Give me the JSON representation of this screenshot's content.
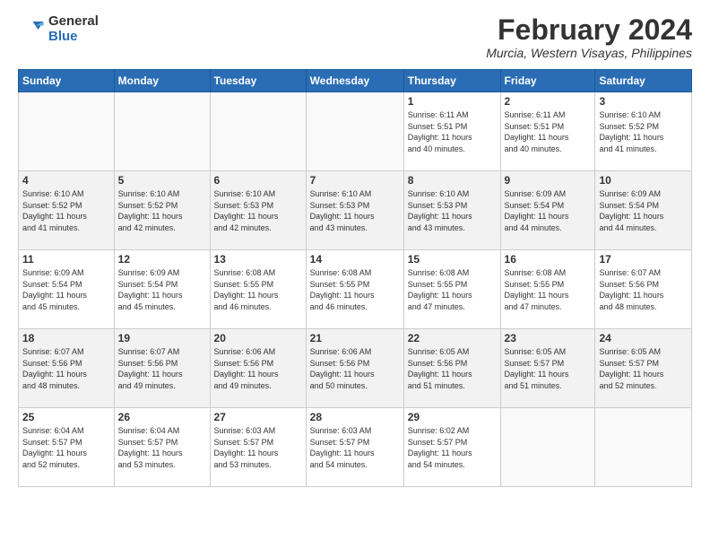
{
  "logo": {
    "general": "General",
    "blue": "Blue"
  },
  "title": "February 2024",
  "location": "Murcia, Western Visayas, Philippines",
  "weekdays": [
    "Sunday",
    "Monday",
    "Tuesday",
    "Wednesday",
    "Thursday",
    "Friday",
    "Saturday"
  ],
  "weeks": [
    [
      {
        "day": "",
        "info": ""
      },
      {
        "day": "",
        "info": ""
      },
      {
        "day": "",
        "info": ""
      },
      {
        "day": "",
        "info": ""
      },
      {
        "day": "1",
        "info": "Sunrise: 6:11 AM\nSunset: 5:51 PM\nDaylight: 11 hours\nand 40 minutes."
      },
      {
        "day": "2",
        "info": "Sunrise: 6:11 AM\nSunset: 5:51 PM\nDaylight: 11 hours\nand 40 minutes."
      },
      {
        "day": "3",
        "info": "Sunrise: 6:10 AM\nSunset: 5:52 PM\nDaylight: 11 hours\nand 41 minutes."
      }
    ],
    [
      {
        "day": "4",
        "info": "Sunrise: 6:10 AM\nSunset: 5:52 PM\nDaylight: 11 hours\nand 41 minutes."
      },
      {
        "day": "5",
        "info": "Sunrise: 6:10 AM\nSunset: 5:52 PM\nDaylight: 11 hours\nand 42 minutes."
      },
      {
        "day": "6",
        "info": "Sunrise: 6:10 AM\nSunset: 5:53 PM\nDaylight: 11 hours\nand 42 minutes."
      },
      {
        "day": "7",
        "info": "Sunrise: 6:10 AM\nSunset: 5:53 PM\nDaylight: 11 hours\nand 43 minutes."
      },
      {
        "day": "8",
        "info": "Sunrise: 6:10 AM\nSunset: 5:53 PM\nDaylight: 11 hours\nand 43 minutes."
      },
      {
        "day": "9",
        "info": "Sunrise: 6:09 AM\nSunset: 5:54 PM\nDaylight: 11 hours\nand 44 minutes."
      },
      {
        "day": "10",
        "info": "Sunrise: 6:09 AM\nSunset: 5:54 PM\nDaylight: 11 hours\nand 44 minutes."
      }
    ],
    [
      {
        "day": "11",
        "info": "Sunrise: 6:09 AM\nSunset: 5:54 PM\nDaylight: 11 hours\nand 45 minutes."
      },
      {
        "day": "12",
        "info": "Sunrise: 6:09 AM\nSunset: 5:54 PM\nDaylight: 11 hours\nand 45 minutes."
      },
      {
        "day": "13",
        "info": "Sunrise: 6:08 AM\nSunset: 5:55 PM\nDaylight: 11 hours\nand 46 minutes."
      },
      {
        "day": "14",
        "info": "Sunrise: 6:08 AM\nSunset: 5:55 PM\nDaylight: 11 hours\nand 46 minutes."
      },
      {
        "day": "15",
        "info": "Sunrise: 6:08 AM\nSunset: 5:55 PM\nDaylight: 11 hours\nand 47 minutes."
      },
      {
        "day": "16",
        "info": "Sunrise: 6:08 AM\nSunset: 5:55 PM\nDaylight: 11 hours\nand 47 minutes."
      },
      {
        "day": "17",
        "info": "Sunrise: 6:07 AM\nSunset: 5:56 PM\nDaylight: 11 hours\nand 48 minutes."
      }
    ],
    [
      {
        "day": "18",
        "info": "Sunrise: 6:07 AM\nSunset: 5:56 PM\nDaylight: 11 hours\nand 48 minutes."
      },
      {
        "day": "19",
        "info": "Sunrise: 6:07 AM\nSunset: 5:56 PM\nDaylight: 11 hours\nand 49 minutes."
      },
      {
        "day": "20",
        "info": "Sunrise: 6:06 AM\nSunset: 5:56 PM\nDaylight: 11 hours\nand 49 minutes."
      },
      {
        "day": "21",
        "info": "Sunrise: 6:06 AM\nSunset: 5:56 PM\nDaylight: 11 hours\nand 50 minutes."
      },
      {
        "day": "22",
        "info": "Sunrise: 6:05 AM\nSunset: 5:56 PM\nDaylight: 11 hours\nand 51 minutes."
      },
      {
        "day": "23",
        "info": "Sunrise: 6:05 AM\nSunset: 5:57 PM\nDaylight: 11 hours\nand 51 minutes."
      },
      {
        "day": "24",
        "info": "Sunrise: 6:05 AM\nSunset: 5:57 PM\nDaylight: 11 hours\nand 52 minutes."
      }
    ],
    [
      {
        "day": "25",
        "info": "Sunrise: 6:04 AM\nSunset: 5:57 PM\nDaylight: 11 hours\nand 52 minutes."
      },
      {
        "day": "26",
        "info": "Sunrise: 6:04 AM\nSunset: 5:57 PM\nDaylight: 11 hours\nand 53 minutes."
      },
      {
        "day": "27",
        "info": "Sunrise: 6:03 AM\nSunset: 5:57 PM\nDaylight: 11 hours\nand 53 minutes."
      },
      {
        "day": "28",
        "info": "Sunrise: 6:03 AM\nSunset: 5:57 PM\nDaylight: 11 hours\nand 54 minutes."
      },
      {
        "day": "29",
        "info": "Sunrise: 6:02 AM\nSunset: 5:57 PM\nDaylight: 11 hours\nand 54 minutes."
      },
      {
        "day": "",
        "info": ""
      },
      {
        "day": "",
        "info": ""
      }
    ]
  ]
}
